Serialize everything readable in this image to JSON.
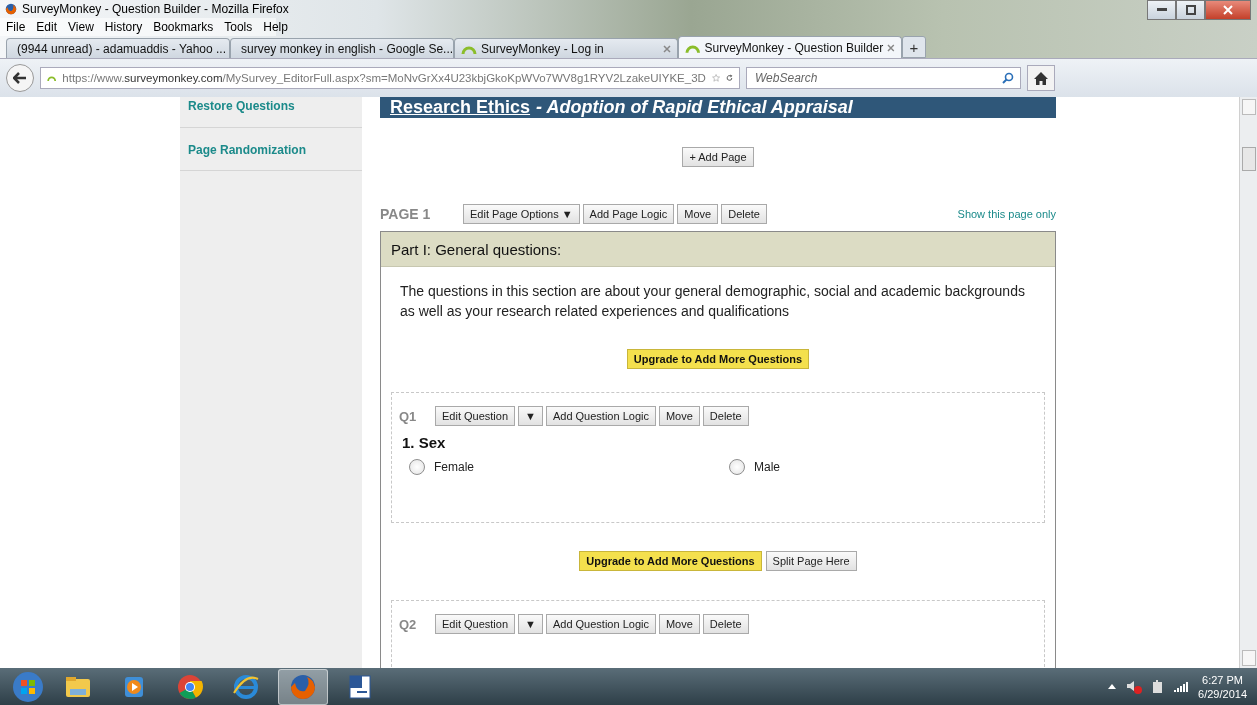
{
  "window": {
    "title": "SurveyMonkey - Question Builder - Mozilla Firefox"
  },
  "menu": [
    "File",
    "Edit",
    "View",
    "History",
    "Bookmarks",
    "Tools",
    "Help"
  ],
  "tabs": [
    {
      "label": "(9944 unread) - adamuaddis - Yahoo ...",
      "kind": "mail",
      "selected": false
    },
    {
      "label": "survey monkey in english - Google Se...",
      "kind": "google",
      "selected": false
    },
    {
      "label": "SurveyMonkey - Log in",
      "kind": "monkey",
      "selected": false
    },
    {
      "label": "SurveyMonkey - Question Builder",
      "kind": "monkey",
      "selected": true
    }
  ],
  "new_tab": "+",
  "address": {
    "url": "https://www.**surveymonkey.com**/MySurvey_EditorFull.aspx?sm=MoNvGrXx4U23kbjGkoKpWVo7WV8g1RYV2LzakeUIYKE_3D"
  },
  "search": {
    "placeholder": "WebSearch"
  },
  "sidebar": {
    "items": [
      "Restore Questions",
      "Page Randomization"
    ]
  },
  "survey": {
    "title": "Research Ethics",
    "subtitle": "- Adoption of Rapid Ethical Appraisal"
  },
  "add_page": "+ Add Page",
  "page": {
    "label": "PAGE 1",
    "buttons": [
      "Edit Page Options ▼",
      "Add Page Logic",
      "Move",
      "Delete"
    ],
    "show_link": "Show this page only"
  },
  "section": {
    "title": "Part I: General questions:",
    "description": "The questions in this section are about your general demographic, social and academic backgrounds as well as your research related experiences and qualifications",
    "upgrade": "Upgrade to Add More Questions"
  },
  "questions": [
    {
      "number": "Q1",
      "buttons": [
        "Edit Question",
        "▼",
        "Add Question Logic",
        "Move",
        "Delete"
      ],
      "title": "1. Sex",
      "options": [
        {
          "label": "Female",
          "selected": false
        },
        {
          "label": "Male",
          "selected": false
        }
      ]
    },
    {
      "number": "Q2",
      "buttons": [
        "Edit Question",
        "▼",
        "Add Question Logic",
        "Move",
        "Delete"
      ]
    }
  ],
  "between": {
    "upgrade": "Upgrade to Add More Questions",
    "split": "Split Page Here"
  },
  "taskbar": {
    "apps": [
      {
        "kind": "explorer",
        "selected": false
      },
      {
        "kind": "media",
        "selected": false
      },
      {
        "kind": "chrome",
        "selected": false
      },
      {
        "kind": "ie",
        "selected": false
      },
      {
        "kind": "firefox",
        "selected": true
      },
      {
        "kind": "word",
        "selected": false
      }
    ],
    "time": "6:27 PM",
    "date": "6/29/2014"
  }
}
